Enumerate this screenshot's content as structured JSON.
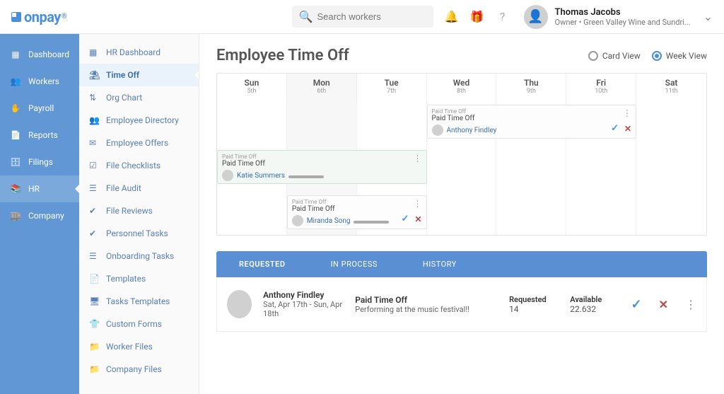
{
  "brand": "onpay",
  "search": {
    "placeholder": "Search workers"
  },
  "user": {
    "name": "Thomas Jacobs",
    "role": "Owner • Green Valley Wine and Sundri..."
  },
  "mainNav": [
    {
      "label": "Dashboard",
      "icon": "▦"
    },
    {
      "label": "Workers",
      "icon": "👥"
    },
    {
      "label": "Payroll",
      "icon": "✋"
    },
    {
      "label": "Reports",
      "icon": "📄"
    },
    {
      "label": "Filings",
      "icon": "🗄"
    },
    {
      "label": "HR",
      "icon": "📚"
    },
    {
      "label": "Company",
      "icon": "🏬"
    }
  ],
  "subNav": [
    {
      "label": "HR Dashboard",
      "icon": "▦"
    },
    {
      "label": "Time Off",
      "icon": "⛱"
    },
    {
      "label": "Org Chart",
      "icon": "⇅"
    },
    {
      "label": "Employee Directory",
      "icon": "👥"
    },
    {
      "label": "Employee Offers",
      "icon": "✉"
    },
    {
      "label": "File Checklists",
      "icon": "☑"
    },
    {
      "label": "File Audit",
      "icon": "☰"
    },
    {
      "label": "File Reviews",
      "icon": "✔"
    },
    {
      "label": "Personnel Tasks",
      "icon": "✔"
    },
    {
      "label": "Onboarding Tasks",
      "icon": "☰"
    },
    {
      "label": "Templates",
      "icon": "📄"
    },
    {
      "label": "Tasks Templates",
      "icon": "🖥"
    },
    {
      "label": "Custom Forms",
      "icon": "👕"
    },
    {
      "label": "Worker Files",
      "icon": "📁"
    },
    {
      "label": "Company Files",
      "icon": "📁"
    }
  ],
  "pageTitle": "Employee Time Off",
  "viewOptions": {
    "card": "Card View",
    "week": "Week View"
  },
  "week": [
    {
      "dow": "Sun",
      "date": "5th"
    },
    {
      "dow": "Mon",
      "date": "6th"
    },
    {
      "dow": "Tue",
      "date": "7th"
    },
    {
      "dow": "Wed",
      "date": "8th"
    },
    {
      "dow": "Thu",
      "date": "9th"
    },
    {
      "dow": "Fri",
      "date": "10th"
    },
    {
      "dow": "Sat",
      "date": "11th"
    }
  ],
  "events": [
    {
      "type": "Paid Time Off",
      "person": "Anthony Findley",
      "status": "pending"
    },
    {
      "type": "Paid Time Off",
      "person": "Katie Summers",
      "status": "approved"
    },
    {
      "type": "Paid Time Off",
      "person": "Miranda Song",
      "status": "pending"
    }
  ],
  "labels": {
    "small": "Paid Time Off"
  },
  "tabs": {
    "requested": "REQUESTED",
    "inprocess": "IN PROCESS",
    "history": "HISTORY"
  },
  "request": {
    "name": "Anthony Findley",
    "dates": "Sat, Apr 17th - Sun, Apr 18th",
    "type": "Paid Time Off",
    "note": "Performing at the music festival!!",
    "requestedLabel": "Requested",
    "requestedVal": "14",
    "availableLabel": "Available",
    "availableVal": "22.632"
  }
}
